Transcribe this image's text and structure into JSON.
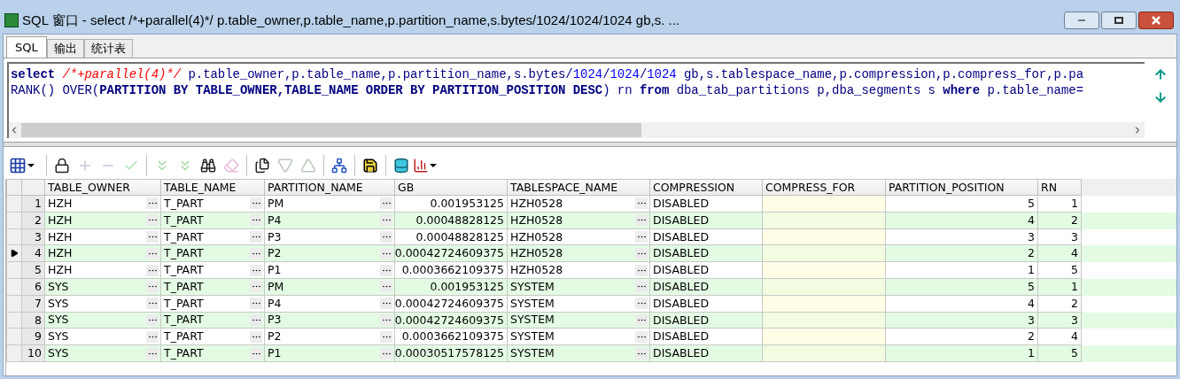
{
  "window": {
    "title": "SQL 窗口 - select /*+parallel(4)*/ p.table_owner,p.table_name,p.partition_name,s.bytes/1024/1024/1024 gb,s. ..."
  },
  "tabs": [
    {
      "label": "SQL",
      "selected": true
    },
    {
      "label": "输出",
      "selected": false
    },
    {
      "label": "统计表",
      "selected": false
    }
  ],
  "editor": {
    "lines": [
      [
        {
          "kind": "keyword",
          "text": "select "
        },
        {
          "kind": "comment",
          "text": "/*+parallel(4)*/"
        },
        {
          "kind": "plain",
          "text": " p.table_owner,p.table_name,p.partition_name,s.bytes/"
        },
        {
          "kind": "number",
          "text": "1024"
        },
        {
          "kind": "plain",
          "text": "/"
        },
        {
          "kind": "number",
          "text": "1024"
        },
        {
          "kind": "plain",
          "text": "/"
        },
        {
          "kind": "number",
          "text": "1024"
        },
        {
          "kind": "plain",
          "text": " gb,s.tablespace_name,p.compression,p.compress_for,p.pa"
        }
      ],
      [
        {
          "kind": "plain",
          "text": "RANK() OVER("
        },
        {
          "kind": "keyword",
          "text": "PARTITION BY TABLE_OWNER,TABLE_NAME ORDER BY PARTITION_POSITION DESC"
        },
        {
          "kind": "plain",
          "text": ") rn "
        },
        {
          "kind": "keyword",
          "text": "from"
        },
        {
          "kind": "plain",
          "text": " dba_tab_partitions p,dba_segments s "
        },
        {
          "kind": "keyword",
          "text": "where"
        },
        {
          "kind": "plain",
          "text": " p.table_name="
        }
      ]
    ]
  },
  "toolbar": [
    {
      "kind": "grid",
      "disabled": false
    },
    {
      "kind": "sep"
    },
    {
      "kind": "lock",
      "disabled": false
    },
    {
      "kind": "plus",
      "disabled": true
    },
    {
      "kind": "minus",
      "disabled": true
    },
    {
      "kind": "check",
      "disabled": true
    },
    {
      "kind": "sep"
    },
    {
      "kind": "down2",
      "disabled": true
    },
    {
      "kind": "down2",
      "disabled": true
    },
    {
      "kind": "find",
      "disabled": false
    },
    {
      "kind": "eraser",
      "disabled": true
    },
    {
      "kind": "sep"
    },
    {
      "kind": "docs",
      "disabled": false
    },
    {
      "kind": "tri-down",
      "disabled": true
    },
    {
      "kind": "tri-up",
      "disabled": true
    },
    {
      "kind": "sep"
    },
    {
      "kind": "tree",
      "disabled": false
    },
    {
      "kind": "sep"
    },
    {
      "kind": "save",
      "disabled": false
    },
    {
      "kind": "sep"
    },
    {
      "kind": "db",
      "disabled": false
    },
    {
      "kind": "chart",
      "disabled": false
    }
  ],
  "table": {
    "columns": [
      {
        "label": "TABLE_OWNER",
        "kind": "text_button"
      },
      {
        "label": "TABLE_NAME",
        "kind": "text_button"
      },
      {
        "label": "PARTITION_NAME",
        "kind": "text_button"
      },
      {
        "label": "GB",
        "kind": "number"
      },
      {
        "label": "TABLESPACE_NAME",
        "kind": "text_button"
      },
      {
        "label": "COMPRESSION",
        "kind": "text"
      },
      {
        "label": "COMPRESS_FOR",
        "kind": "null"
      },
      {
        "label": "PARTITION_POSITION",
        "kind": "number"
      },
      {
        "label": "RN",
        "kind": "number"
      }
    ],
    "rows": [
      {
        "number": "1",
        "current": false,
        "cells": [
          "HZH",
          "T_PART",
          "PM",
          "0.001953125",
          "HZH0528",
          "DISABLED",
          "",
          "5",
          "1"
        ]
      },
      {
        "number": "2",
        "current": false,
        "cells": [
          "HZH",
          "T_PART",
          "P4",
          "0.00048828125",
          "HZH0528",
          "DISABLED",
          "",
          "4",
          "2"
        ]
      },
      {
        "number": "3",
        "current": false,
        "cells": [
          "HZH",
          "T_PART",
          "P3",
          "0.00048828125",
          "HZH0528",
          "DISABLED",
          "",
          "3",
          "3"
        ]
      },
      {
        "number": "4",
        "current": true,
        "cells": [
          "HZH",
          "T_PART",
          "P2",
          "0.00042724609375",
          "HZH0528",
          "DISABLED",
          "",
          "2",
          "4"
        ]
      },
      {
        "number": "5",
        "current": false,
        "cells": [
          "HZH",
          "T_PART",
          "P1",
          "0.0003662109375",
          "HZH0528",
          "DISABLED",
          "",
          "1",
          "5"
        ]
      },
      {
        "number": "6",
        "current": false,
        "cells": [
          "SYS",
          "T_PART",
          "PM",
          "0.001953125",
          "SYSTEM",
          "DISABLED",
          "",
          "5",
          "1"
        ]
      },
      {
        "number": "7",
        "current": false,
        "cells": [
          "SYS",
          "T_PART",
          "P4",
          "0.00042724609375",
          "SYSTEM",
          "DISABLED",
          "",
          "4",
          "2"
        ]
      },
      {
        "number": "8",
        "current": false,
        "cells": [
          "SYS",
          "T_PART",
          "P3",
          "0.00042724609375",
          "SYSTEM",
          "DISABLED",
          "",
          "3",
          "3"
        ]
      },
      {
        "number": "9",
        "current": false,
        "cells": [
          "SYS",
          "T_PART",
          "P2",
          "0.0003662109375",
          "SYSTEM",
          "DISABLED",
          "",
          "2",
          "4"
        ]
      },
      {
        "number": "10",
        "current": false,
        "cells": [
          "SYS",
          "T_PART",
          "P1",
          "0.00030517578125",
          "SYSTEM",
          "DISABLED",
          "",
          "1",
          "5"
        ]
      }
    ]
  }
}
